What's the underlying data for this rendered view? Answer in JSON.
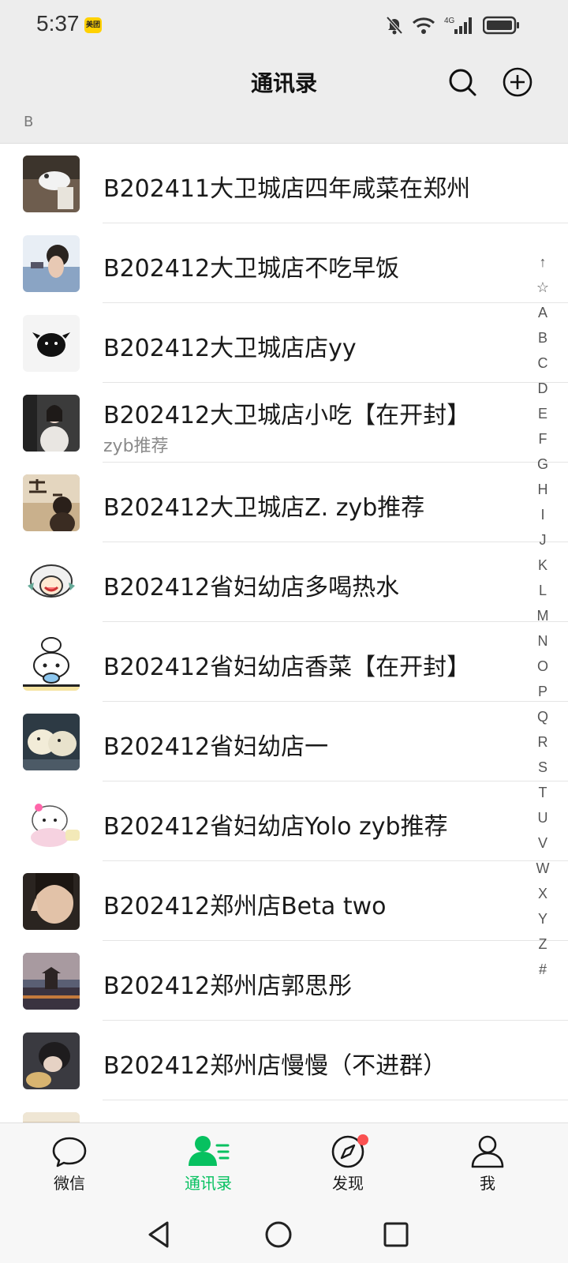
{
  "status": {
    "time": "5:37",
    "badge": "美团",
    "network": "4G"
  },
  "header": {
    "title": "通讯录",
    "search_icon": "search-icon",
    "add_icon": "plus-circle-icon"
  },
  "section": {
    "letter": "B"
  },
  "contacts": [
    {
      "name": "B202411大卫城店四年咸菜在郑州",
      "sub": ""
    },
    {
      "name": "B202412大卫城店不吃早饭",
      "sub": ""
    },
    {
      "name": "B202412大卫城店店yy",
      "sub": ""
    },
    {
      "name": "B202412大卫城店小吃【在开封】",
      "sub": "zyb推荐"
    },
    {
      "name": "B202412大卫城店Z. zyb推荐",
      "sub": ""
    },
    {
      "name": "B202412省妇幼店多喝热水",
      "sub": ""
    },
    {
      "name": "B202412省妇幼店香菜【在开封】",
      "sub": ""
    },
    {
      "name": "B202412省妇幼店一",
      "sub": ""
    },
    {
      "name": "B202412省妇幼店Yolo zyb推荐",
      "sub": ""
    },
    {
      "name": "B202412郑州店Beta two",
      "sub": ""
    },
    {
      "name": "B202412郑州店郭思彤",
      "sub": ""
    },
    {
      "name": "B202412郑州店慢慢（不进群）",
      "sub": ""
    }
  ],
  "index": [
    "↑",
    "☆",
    "A",
    "B",
    "C",
    "D",
    "E",
    "F",
    "G",
    "H",
    "I",
    "J",
    "K",
    "L",
    "M",
    "N",
    "O",
    "P",
    "Q",
    "R",
    "S",
    "T",
    "U",
    "V",
    "W",
    "X",
    "Y",
    "Z",
    "#"
  ],
  "tabs": [
    {
      "label": "微信",
      "icon": "chat-bubble-icon"
    },
    {
      "label": "通讯录",
      "icon": "contacts-icon"
    },
    {
      "label": "发现",
      "icon": "compass-icon"
    },
    {
      "label": "我",
      "icon": "person-icon"
    }
  ],
  "colors": {
    "accent": "#07c160",
    "badge_red": "#fa5151",
    "bar_bg": "#ededed"
  }
}
